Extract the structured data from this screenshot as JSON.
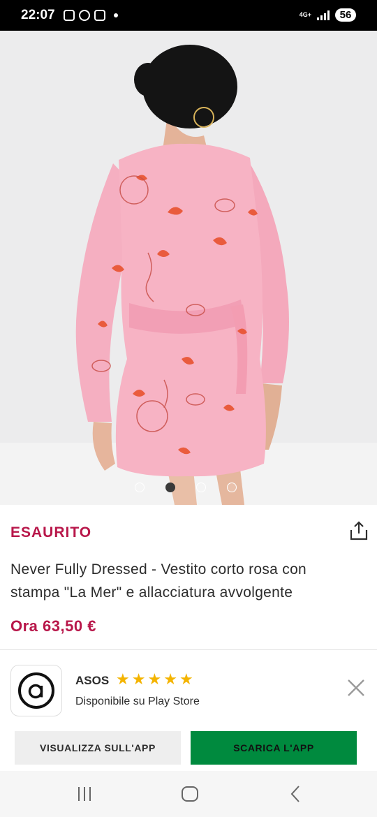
{
  "status_bar": {
    "time": "22:07",
    "network": "4G+",
    "battery": "56",
    "notification_icons": [
      "screenshot-icon",
      "messenger-icon",
      "instagram-icon",
      "dot-icon"
    ]
  },
  "gallery": {
    "image_description_icon": "product-photo",
    "slide_count": 4,
    "active_slide": 1
  },
  "product": {
    "availability": "ESAURITO",
    "title": "Never Fully Dressed - Vestito corto rosa con stampa \"La Mer\" e allacciatura avvolgente",
    "price": "Ora 63,50 €"
  },
  "app_banner": {
    "app_name": "ASOS",
    "rating_stars": 5,
    "subtitle": "Disponibile su Play Store",
    "view_button": "VISUALIZZA SULL'APP",
    "download_button": "SCARICA L'APP"
  },
  "colors": {
    "sale_red": "#b8174a",
    "download_green": "#008a3e",
    "star_yellow": "#f4b400",
    "dress_pink": "#f7b3c4"
  }
}
